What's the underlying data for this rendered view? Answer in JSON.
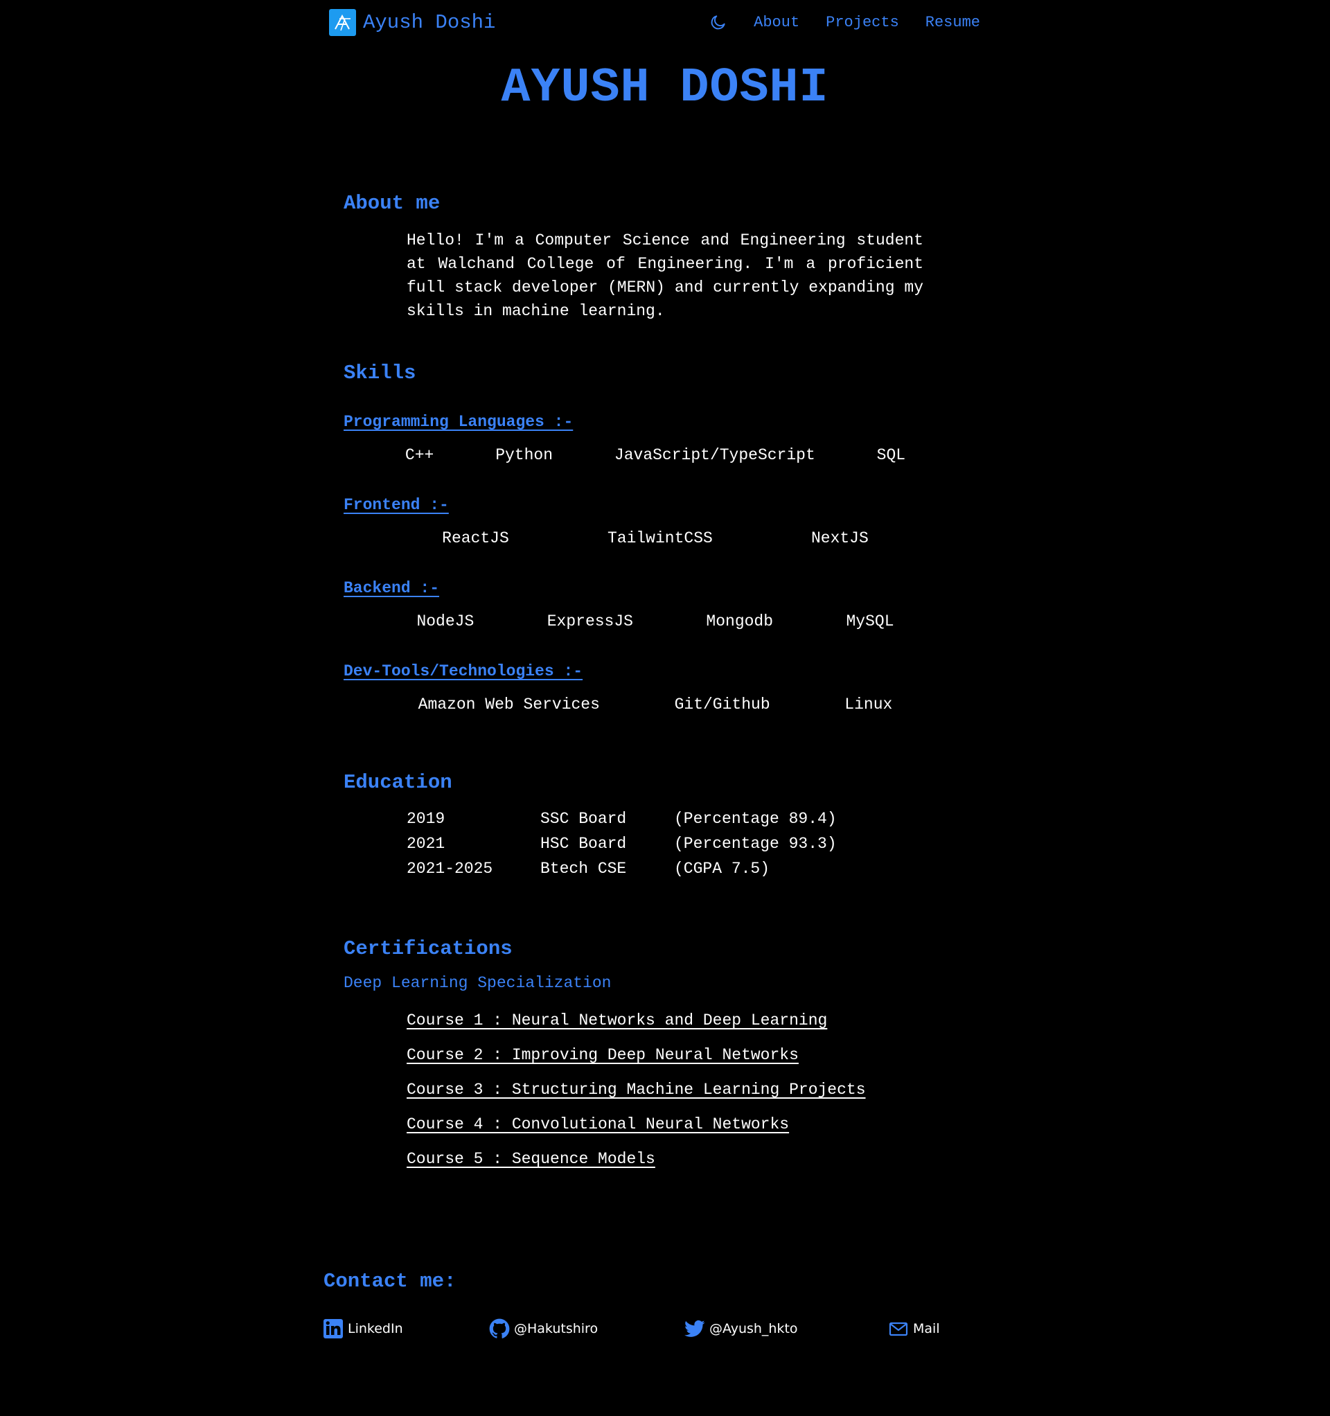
{
  "header": {
    "brand_name": "Ayush Doshi",
    "nav": [
      "About",
      "Projects",
      "Resume"
    ]
  },
  "hero_title": "AYUSH DOSHI",
  "about": {
    "heading": "About me",
    "text": "Hello! I'm a Computer Science and Engineering student at Walchand College of Engineering. I'm a proficient full stack developer (MERN) and currently expanding my skills in machine learning."
  },
  "skills": {
    "heading": "Skills",
    "groups": [
      {
        "title": "Programming Languages :-",
        "items": [
          "C++",
          "Python",
          "JavaScript/TypeScript",
          "SQL"
        ]
      },
      {
        "title": "Frontend :-",
        "items": [
          "ReactJS",
          "TailwintCSS",
          "NextJS"
        ]
      },
      {
        "title": "Backend :-",
        "items": [
          "NodeJS",
          "ExpressJS",
          "Mongodb",
          "MySQL"
        ]
      },
      {
        "title": "Dev-Tools/Technologies :-",
        "items": [
          "Amazon Web Services",
          "Git/Github",
          "Linux"
        ]
      }
    ]
  },
  "education": {
    "heading": "Education",
    "rows": [
      {
        "year": "2019",
        "degree": "SSC Board",
        "score": "(Percentage 89.4)"
      },
      {
        "year": "2021",
        "degree": "HSC Board",
        "score": "(Percentage 93.3)"
      },
      {
        "year": "2021-2025",
        "degree": "Btech CSE",
        "score": "(CGPA 7.5)"
      }
    ]
  },
  "certifications": {
    "heading": "Certifications",
    "specialization": "Deep Learning Specialization",
    "courses": [
      "Course 1 : Neural Networks and Deep Learning",
      "Course 2 : Improving Deep Neural Networks",
      "Course 3 : Structuring Machine Learning Projects",
      "Course 4 : Convolutional Neural Networks",
      "Course 5 : Sequence Models"
    ]
  },
  "contact": {
    "heading": "Contact me:",
    "items": [
      {
        "label": "LinkedIn",
        "icon": "linkedin-icon"
      },
      {
        "label": "@Hakutshiro",
        "icon": "github-icon"
      },
      {
        "label": "@Ayush_hkto",
        "icon": "twitter-icon"
      },
      {
        "label": "Mail",
        "icon": "mail-icon"
      }
    ]
  },
  "colors": {
    "background": "#000000",
    "accent": "#3b82f6",
    "text": "#ffffff",
    "logo_bg": "#1d9bf0"
  }
}
